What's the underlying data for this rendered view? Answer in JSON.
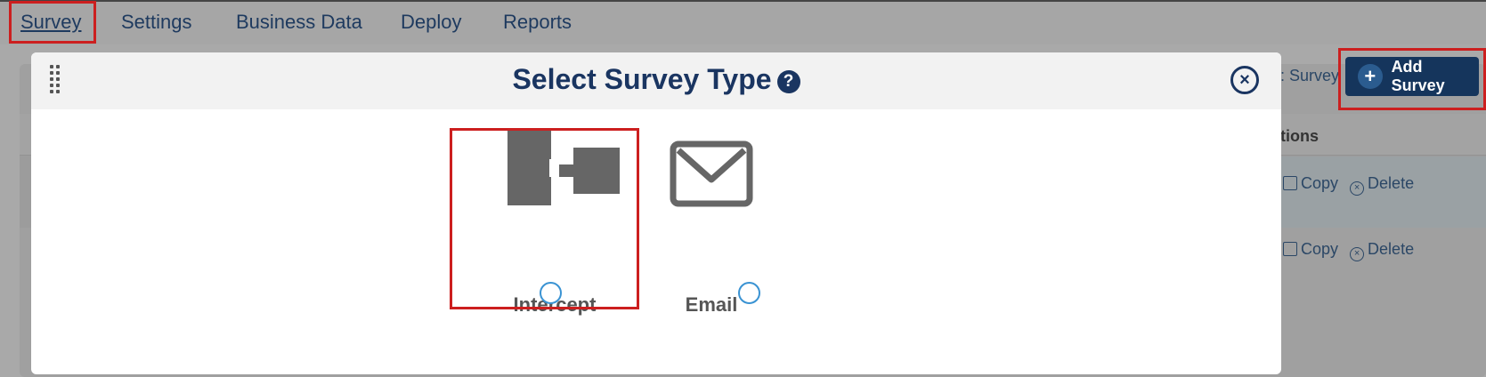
{
  "nav": {
    "items": [
      "Survey",
      "Settings",
      "Business Data",
      "Deploy",
      "Reports"
    ]
  },
  "background": {
    "toolbar_partial_text": ": Survey",
    "add_survey_label": "Add Survey",
    "actions_header": "tions",
    "rows": [
      {
        "copy": "Copy",
        "delete": "Delete"
      },
      {
        "copy": "Copy",
        "delete": "Delete"
      }
    ]
  },
  "modal": {
    "title": "Select Survey Type",
    "help_glyph": "?",
    "close_glyph": "×",
    "options": [
      {
        "label": "Intercept",
        "icon": "intercept-icon"
      },
      {
        "label": "Email",
        "icon": "envelope-icon"
      }
    ]
  },
  "colors": {
    "highlight": "#cc1f1f",
    "navy": "#1a3561",
    "radio": "#3a93d3",
    "icon_gray": "#666666"
  }
}
